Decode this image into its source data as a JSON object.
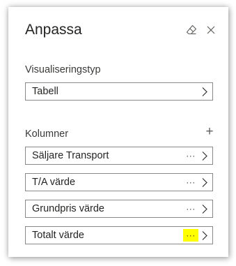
{
  "panel": {
    "title": "Anpassa",
    "header_icons": [
      "eraser-icon",
      "close-icon"
    ]
  },
  "visualization": {
    "label": "Visualiseringstyp",
    "value": "Tabell"
  },
  "columns": {
    "label": "Kolumner",
    "add_symbol": "+",
    "more_symbol": "···",
    "items": [
      {
        "label": "Säljare Transport",
        "highlighted": false
      },
      {
        "label": "T/A värde",
        "highlighted": false
      },
      {
        "label": "Grundpris värde",
        "highlighted": false
      },
      {
        "label": "Totalt värde",
        "highlighted": true
      }
    ]
  },
  "colors": {
    "highlight": "#ffff00",
    "border": "#8a8886",
    "text": "#252423"
  }
}
